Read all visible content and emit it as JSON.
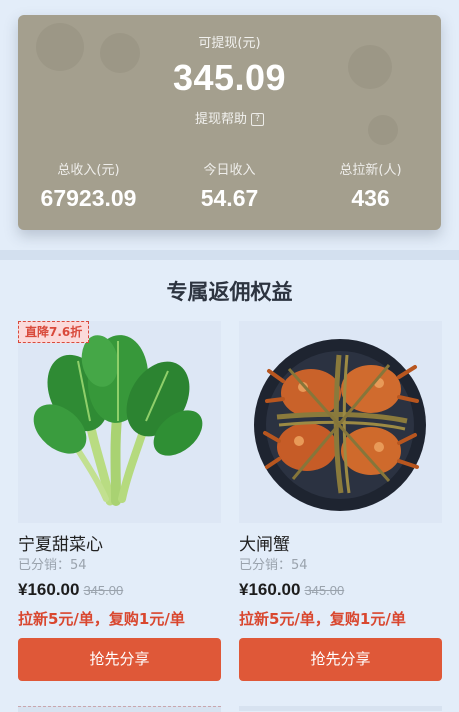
{
  "earnings": {
    "withdrawable_label": "可提现(元)",
    "withdrawable_amount": "345.09",
    "help_label": "提现帮助",
    "help_icon": "?",
    "stats": [
      {
        "label": "总收入(元)",
        "value": "67923.09"
      },
      {
        "label": "今日收入",
        "value": "54.67"
      },
      {
        "label": "总拉新(人)",
        "value": "436"
      }
    ]
  },
  "section": {
    "title": "专属返佣权益"
  },
  "products": [
    {
      "badge": "直降7.6折",
      "name": "宁夏甜菜心",
      "sold": "已分销：54",
      "price": "¥160.00",
      "original_price": "345.00",
      "rebate": "拉新5元/单，复购1元/单",
      "button": "抢先分享",
      "image_icon": "leafy-vegetable"
    },
    {
      "name": "大闸蟹",
      "sold": "已分销：54",
      "price": "¥160.00",
      "original_price": "345.00",
      "rebate": "拉新5元/单，复购1元/单",
      "button": "抢先分享",
      "image_icon": "hairy-crab"
    }
  ],
  "colors": {
    "card_bg": "#a49f8e",
    "page_bg": "#e3edf9",
    "accent": "#df5838",
    "rebate_text": "#d9472f"
  }
}
